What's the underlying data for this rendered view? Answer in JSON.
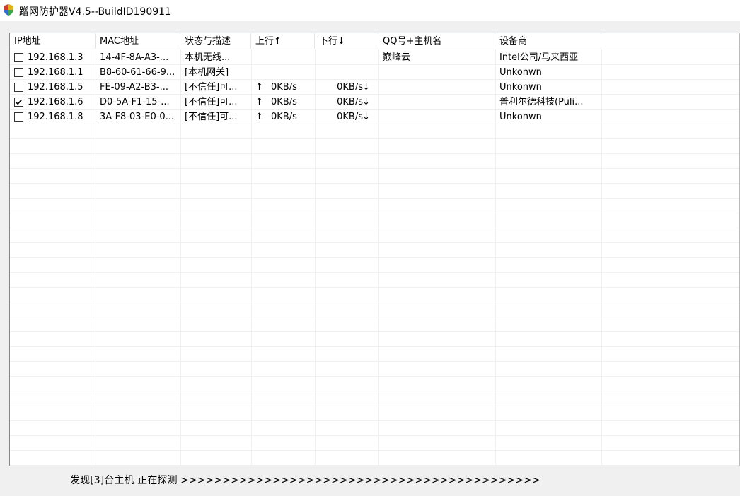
{
  "window": {
    "title": "蹭网防护器V4.5--BuildID190911",
    "app_icon": "shield-icon"
  },
  "table": {
    "columns": [
      "IP地址",
      "MAC地址",
      "状态与描述",
      "上行↑",
      "下行↓",
      "QQ号+主机名",
      "设备商"
    ],
    "rows": [
      {
        "checked": false,
        "ip": "192.168.1.3",
        "mac": "14-4F-8A-A3-...",
        "status": "本机无线...",
        "up_arrow": "",
        "up": "",
        "down": "",
        "down_arrow": "",
        "qq_host": "巅峰云",
        "vendor": "Intel公司/马来西亚"
      },
      {
        "checked": false,
        "ip": "192.168.1.1",
        "mac": "B8-60-61-66-9...",
        "status": "[本机网关]",
        "up_arrow": "",
        "up": "",
        "down": "",
        "down_arrow": "",
        "qq_host": "",
        "vendor": "Unkonwn"
      },
      {
        "checked": false,
        "ip": "192.168.1.5",
        "mac": "FE-09-A2-B3-...",
        "status": "[不信任]可...",
        "up_arrow": "↑",
        "up": "0KB/s",
        "down": "0KB/s",
        "down_arrow": "↓",
        "qq_host": "",
        "vendor": "Unkonwn"
      },
      {
        "checked": true,
        "ip": "192.168.1.6",
        "mac": "D0-5A-F1-15-...",
        "status": "[不信任]可...",
        "up_arrow": "↑",
        "up": "0KB/s",
        "down": "0KB/s",
        "down_arrow": "↓",
        "qq_host": "",
        "vendor": "普利尔德科技(Puli..."
      },
      {
        "checked": false,
        "ip": "192.168.1.8",
        "mac": "3A-F8-03-E0-0...",
        "status": "[不信任]可...",
        "up_arrow": "↑",
        "up": "0KB/s",
        "down": "0KB/s",
        "down_arrow": "↓",
        "qq_host": "",
        "vendor": "Unkonwn"
      }
    ]
  },
  "status_bar": {
    "text": "发现[3]台主机  正在探测 >>>>>>>>>>>>>>>>>>>>>>>>>>>>>>>>>>>>>>>>>>>"
  }
}
